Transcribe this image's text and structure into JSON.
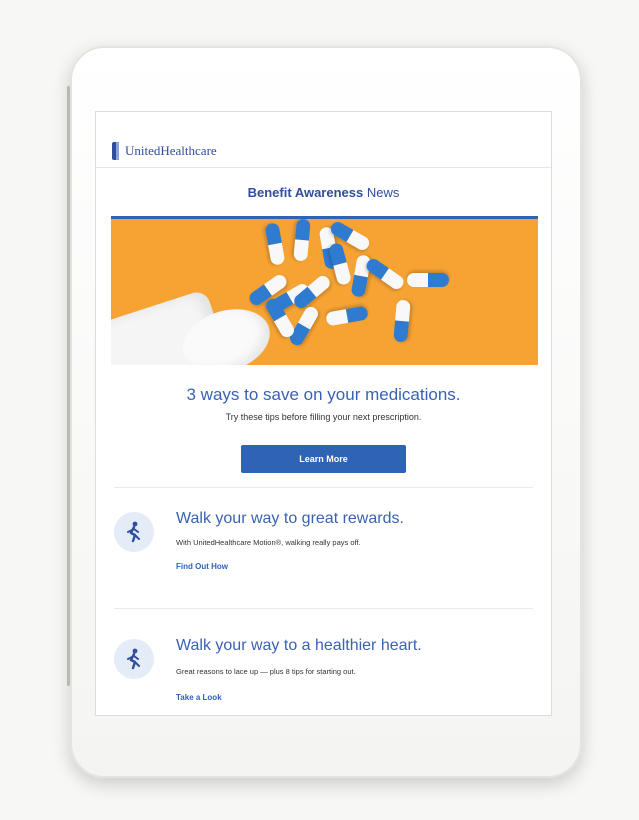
{
  "brand": {
    "name": "UnitedHealthcare"
  },
  "newsletter": {
    "bold": "Benefit Awareness",
    "regular": "News"
  },
  "hero": {
    "title": "3 ways to save on your medications.",
    "subtitle": "Try these tips before filling your next prescription.",
    "button": "Learn More"
  },
  "articles": [
    {
      "title": "Walk your way to great rewards.",
      "subtitle": "With UnitedHealthcare Motion®, walking really pays off.",
      "link": "Find Out How",
      "icon": "walking-person-icon"
    },
    {
      "title": "Walk your way to a healthier heart.",
      "subtitle": "Great reasons to lace up — plus 8 tips for starting out.",
      "link": "Take a Look",
      "icon": "walking-person-icon"
    }
  ],
  "colors": {
    "brand_blue": "#2f63b3",
    "hero_orange": "#f6a334",
    "pill_blue": "#2f7bd0"
  }
}
